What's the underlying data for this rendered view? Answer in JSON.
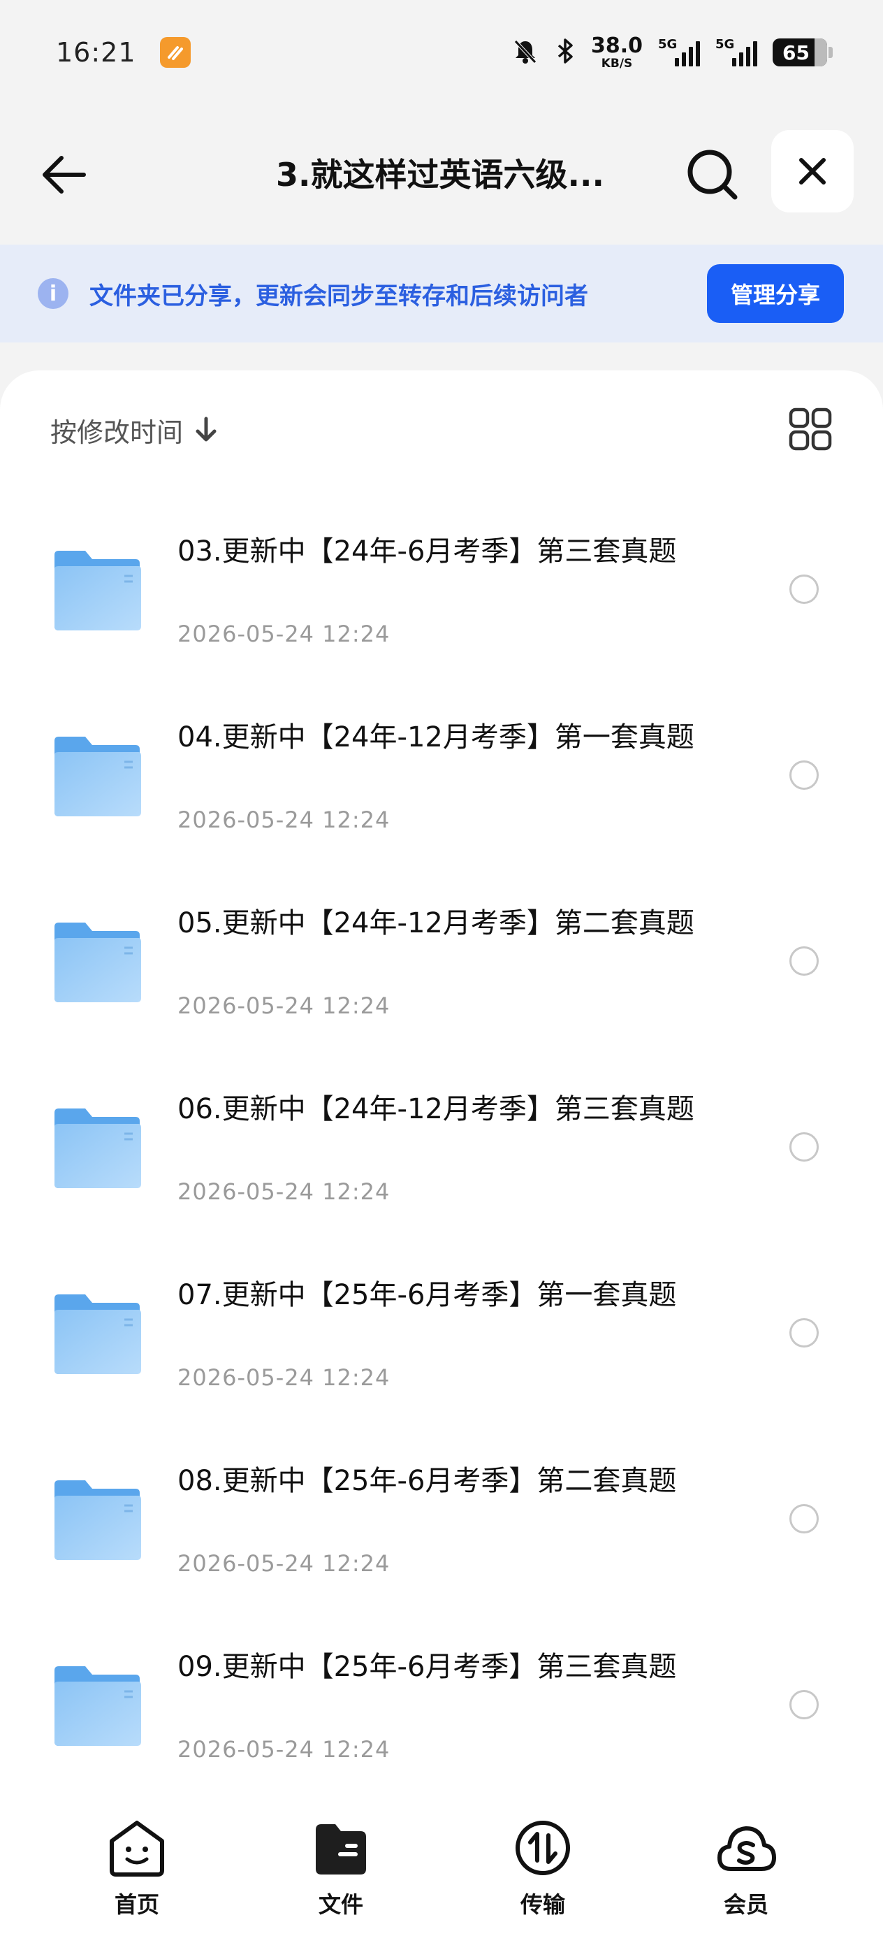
{
  "status_bar": {
    "time": "16:21",
    "network_speed": "38.0",
    "network_speed_unit": "KB/S",
    "signal_1_label": "5G",
    "signal_2_label": "5G",
    "battery_level": "65"
  },
  "header": {
    "title": "3.就这样过英语六级...",
    "back_icon": "arrow-left-icon",
    "search_icon": "search-icon",
    "close_icon": "close-icon"
  },
  "share_banner": {
    "text": "文件夹已分享，更新会同步至转存和后续访问者",
    "button_label": "管理分享",
    "accent_color": "#1a5ef5"
  },
  "toolbar": {
    "sort_label": "按修改时间",
    "sort_icon": "arrow-down-icon",
    "view_icon": "grid-view-icon"
  },
  "files": [
    {
      "name": "03.更新中【24年-6月考季】第三套真题",
      "date": "2026-05-24 12:24"
    },
    {
      "name": "04.更新中【24年-12月考季】第一套真题",
      "date": "2026-05-24 12:24"
    },
    {
      "name": "05.更新中【24年-12月考季】第二套真题",
      "date": "2026-05-24 12:24"
    },
    {
      "name": "06.更新中【24年-12月考季】第三套真题",
      "date": "2026-05-24 12:24"
    },
    {
      "name": "07.更新中【25年-6月考季】第一套真题",
      "date": "2026-05-24 12:24"
    },
    {
      "name": "08.更新中【25年-6月考季】第二套真题",
      "date": "2026-05-24 12:24"
    },
    {
      "name": "09.更新中【25年-6月考季】第三套真题",
      "date": "2026-05-24 12:24"
    }
  ],
  "bottom_nav": [
    {
      "label": "首页",
      "icon": "home-face-icon"
    },
    {
      "label": "文件",
      "icon": "folder-icon",
      "active": true
    },
    {
      "label": "传输",
      "icon": "transfer-icon"
    },
    {
      "label": "会员",
      "icon": "cloud-membership-icon"
    }
  ]
}
